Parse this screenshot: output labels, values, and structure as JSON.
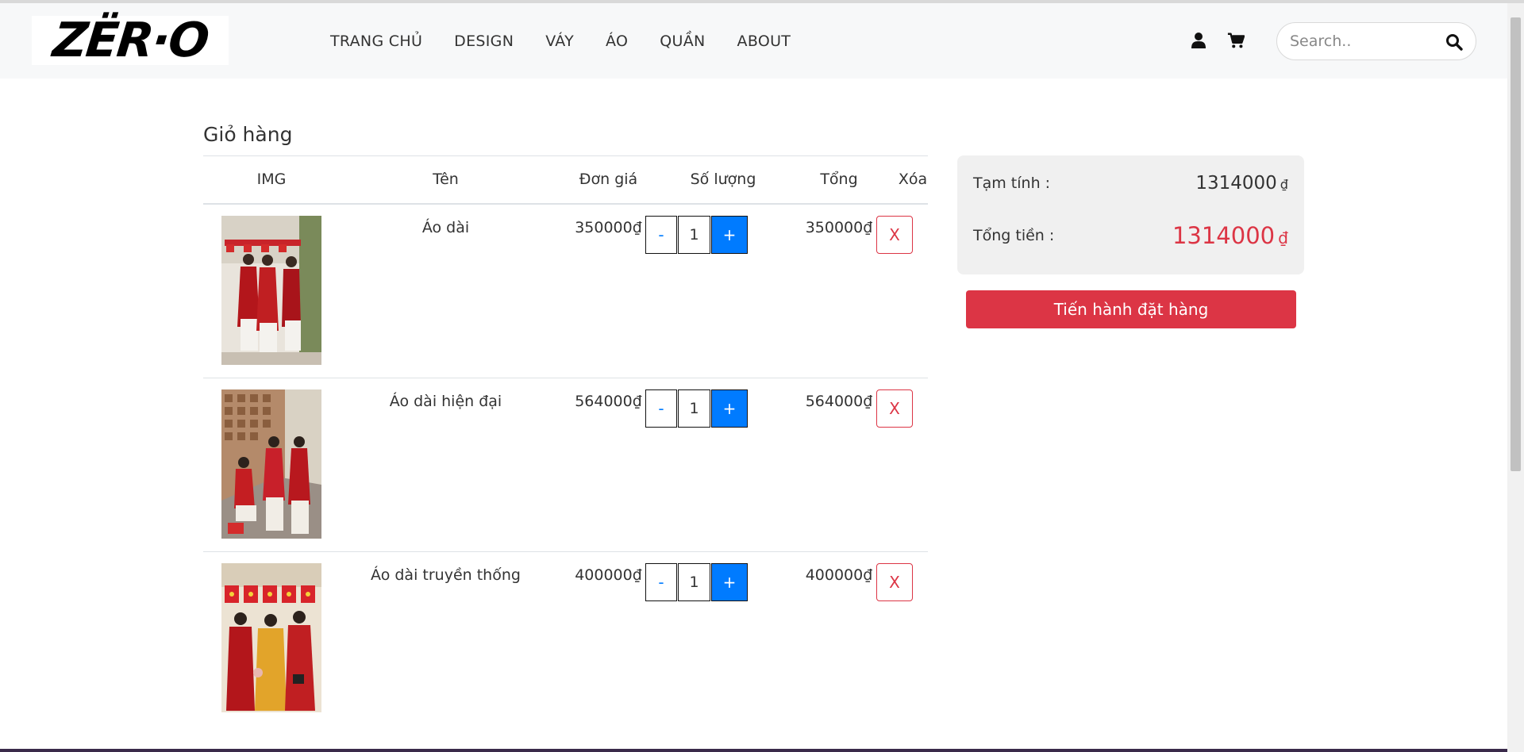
{
  "brand": {
    "logo_text": "ZËR·O"
  },
  "nav": {
    "links": [
      "TRANG CHỦ",
      "DESIGN",
      "VÁY",
      "ÁO",
      "QUẦN",
      "ABOUT"
    ],
    "icons": [
      "user-icon",
      "cart-icon"
    ]
  },
  "search": {
    "placeholder": "Search.."
  },
  "cart": {
    "title": "Giỏ hàng",
    "headers": {
      "img": "IMG",
      "name": "Tên",
      "price": "Đơn giá",
      "qty": "Số lượng",
      "total": "Tổng",
      "delete": "Xóa"
    },
    "items": [
      {
        "name": "Áo dài",
        "price": "350000₫",
        "qty": "1",
        "total": "350000₫",
        "minus": "-",
        "plus": "+",
        "delete": "X"
      },
      {
        "name": "Áo dài hiện đại",
        "price": "564000₫",
        "qty": "1",
        "total": "564000₫",
        "minus": "-",
        "plus": "+",
        "delete": "X"
      },
      {
        "name": "Áo dài truyền thống",
        "price": "400000₫",
        "qty": "1",
        "total": "400000₫",
        "minus": "-",
        "plus": "+",
        "delete": "X"
      }
    ]
  },
  "summary": {
    "subtotal_label": "Tạm tính :",
    "subtotal_value": "1314000",
    "total_label": "Tổng tiền :",
    "total_value": "1314000",
    "currency": "₫",
    "checkout_label": "Tiến hành đặt hàng"
  },
  "colors": {
    "accent_blue": "#007bff",
    "accent_red": "#dc3545",
    "navbar_bg": "#f7f8f9"
  }
}
